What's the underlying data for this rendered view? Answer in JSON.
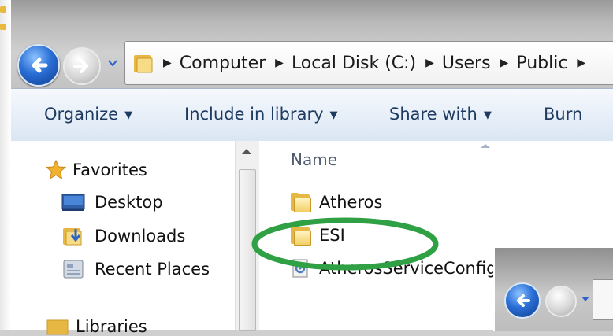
{
  "address_bar": {
    "breadcrumbs": [
      "Computer",
      "Local Disk (C:)",
      "Users",
      "Public"
    ]
  },
  "toolbar": {
    "organize": "Organize",
    "include_in_library": "Include in library",
    "share_with": "Share with",
    "burn": "Burn"
  },
  "nav_pane": {
    "favorites": "Favorites",
    "desktop": "Desktop",
    "downloads": "Downloads",
    "recent_places": "Recent Places",
    "libraries": "Libraries"
  },
  "file_list": {
    "column_name": "Name",
    "items": [
      "Atheros",
      "ESI",
      "AtherosServiceConfig"
    ]
  },
  "colors": {
    "highlight_ellipse": "#2fa043",
    "back_button": "#2a6fd6",
    "folder": "#e7b743",
    "toolbar_text": "#1e3a5f"
  }
}
